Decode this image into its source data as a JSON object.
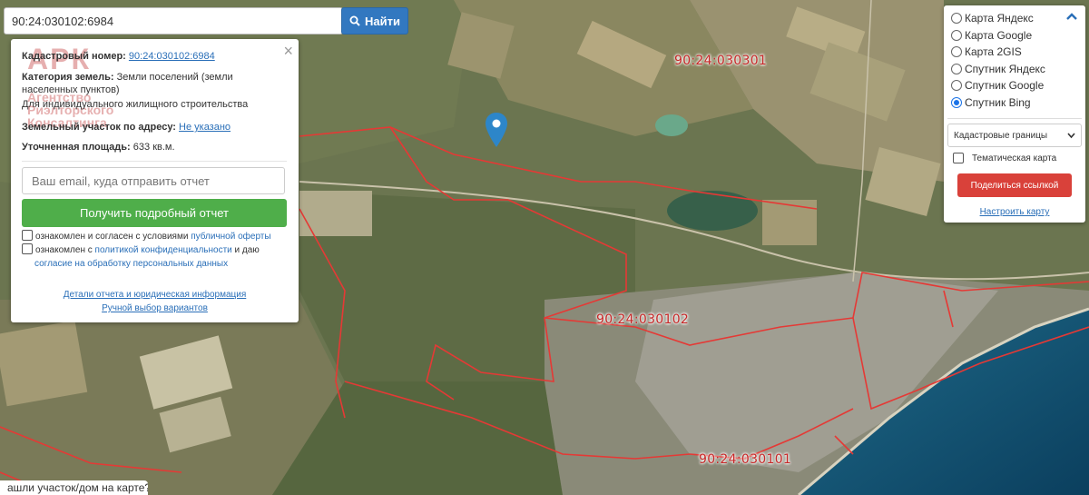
{
  "search": {
    "value": "90:24:030102:6984",
    "button_label": "Найти"
  },
  "map": {
    "zone_labels": [
      "90:24:030301",
      "90:24:030102",
      "90:24:030101"
    ],
    "boundary_color": "#e53935",
    "sea_color": "#0d4a6b"
  },
  "info_panel": {
    "watermark_lines": [
      "АРК",
      "Агентство",
      "Риэлторского",
      "Консалтинга"
    ],
    "cadastral_label": "Кадастровый номер:",
    "cadastral_value": "90:24:030102:6984",
    "category_label": "Категория земель:",
    "category_value": "Земли поселений (земли населенных пунктов)",
    "usage_value": "Для индивидуального жилищного строительства",
    "address_label": "Земельный участок по адресу:",
    "address_value": "Не указано",
    "area_label": "Уточненная площадь:",
    "area_value": "633 кв.м.",
    "email_placeholder": "Ваш email, куда отправить отчет",
    "report_button": "Получить подробный отчет",
    "offer_text": "ознакомлен и согласен с условиями",
    "offer_link": "публичной оферты",
    "privacy_text": "ознакомлен с",
    "privacy_link": "политикой конфиденциальности",
    "privacy_and": "и даю",
    "consent_link": "согласие на обработку персональных данных",
    "details_link": "Детали отчета и юридическая информация",
    "manual_link": "Ручной выбор вариантов"
  },
  "layers": {
    "options": [
      {
        "label": "Карта Яндекс",
        "selected": false
      },
      {
        "label": "Карта Google",
        "selected": false
      },
      {
        "label": "Карта 2GIS",
        "selected": false
      },
      {
        "label": "Спутник Яндекс",
        "selected": false
      },
      {
        "label": "Спутник Google",
        "selected": false
      },
      {
        "label": "Спутник Bing",
        "selected": true
      }
    ],
    "boundary_select": "Кадастровые границы",
    "thematic_label": "Тематическая карта",
    "share_button": "Поделиться ссылкой",
    "configure_link": "Настроить карту"
  },
  "footer": {
    "text": "ашли участок/дом на карте?"
  }
}
